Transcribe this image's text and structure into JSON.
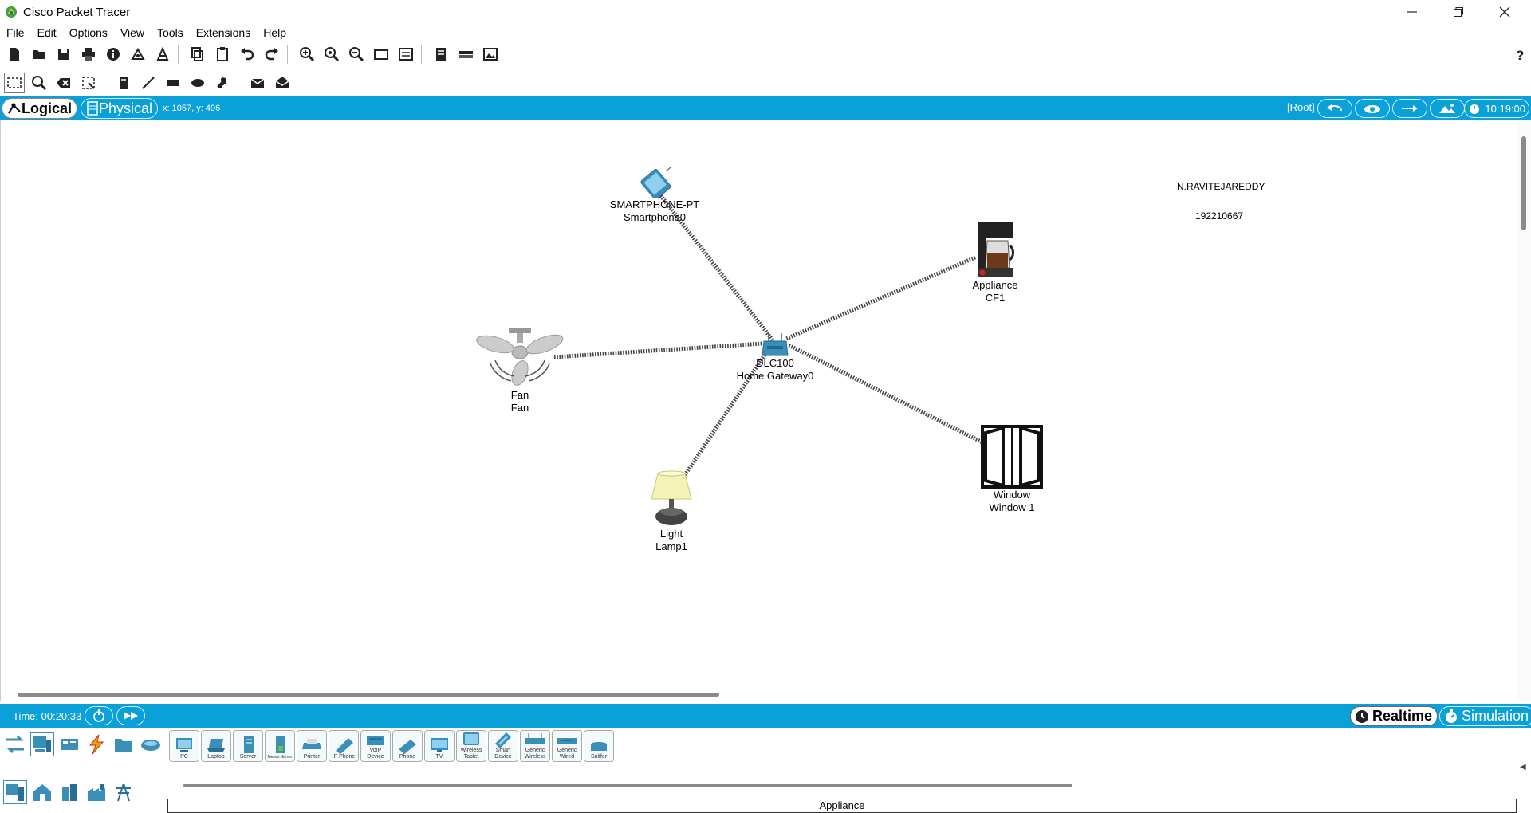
{
  "window": {
    "title": "Cisco Packet Tracer"
  },
  "menu": [
    "File",
    "Edit",
    "Options",
    "View",
    "Tools",
    "Extensions",
    "Help"
  ],
  "workspace": {
    "logical_label": "Logical",
    "physical_label": "Physical",
    "coords": "x: 1057, y: 496",
    "root_label": "[Root]",
    "clock": "10:19:00"
  },
  "devices": {
    "smartphone": {
      "line1": "SMARTPHONE-PT",
      "line2": "Smartphone0"
    },
    "gateway": {
      "line1": "DLC100",
      "line2": "Home Gateway0"
    },
    "appliance": {
      "line1": "Appliance",
      "line2": "CF1"
    },
    "fan": {
      "line1": "Fan",
      "line2": "Fan"
    },
    "lamp": {
      "line1": "Light",
      "line2": "Lamp1"
    },
    "window": {
      "line1": "Window",
      "line2": "Window 1"
    }
  },
  "notes": {
    "name": "N.RAVITEJAREDDY",
    "id": "192210667"
  },
  "timebar": {
    "time": "Time: 00:20:33",
    "realtime": "Realtime",
    "simulation": "Simulation"
  },
  "device_types": [
    "PC",
    "Laptop",
    "Server",
    "Meraki Server",
    "Printer",
    "IP Phone",
    "VoIP Device",
    "Phone",
    "TV",
    "Wireless Tablet",
    "Smart Device",
    "Generic Wireless",
    "Generic Wired",
    "Sniffer"
  ],
  "status_bar": "Appliance",
  "colors": {
    "accent": "#0aa0d8"
  }
}
